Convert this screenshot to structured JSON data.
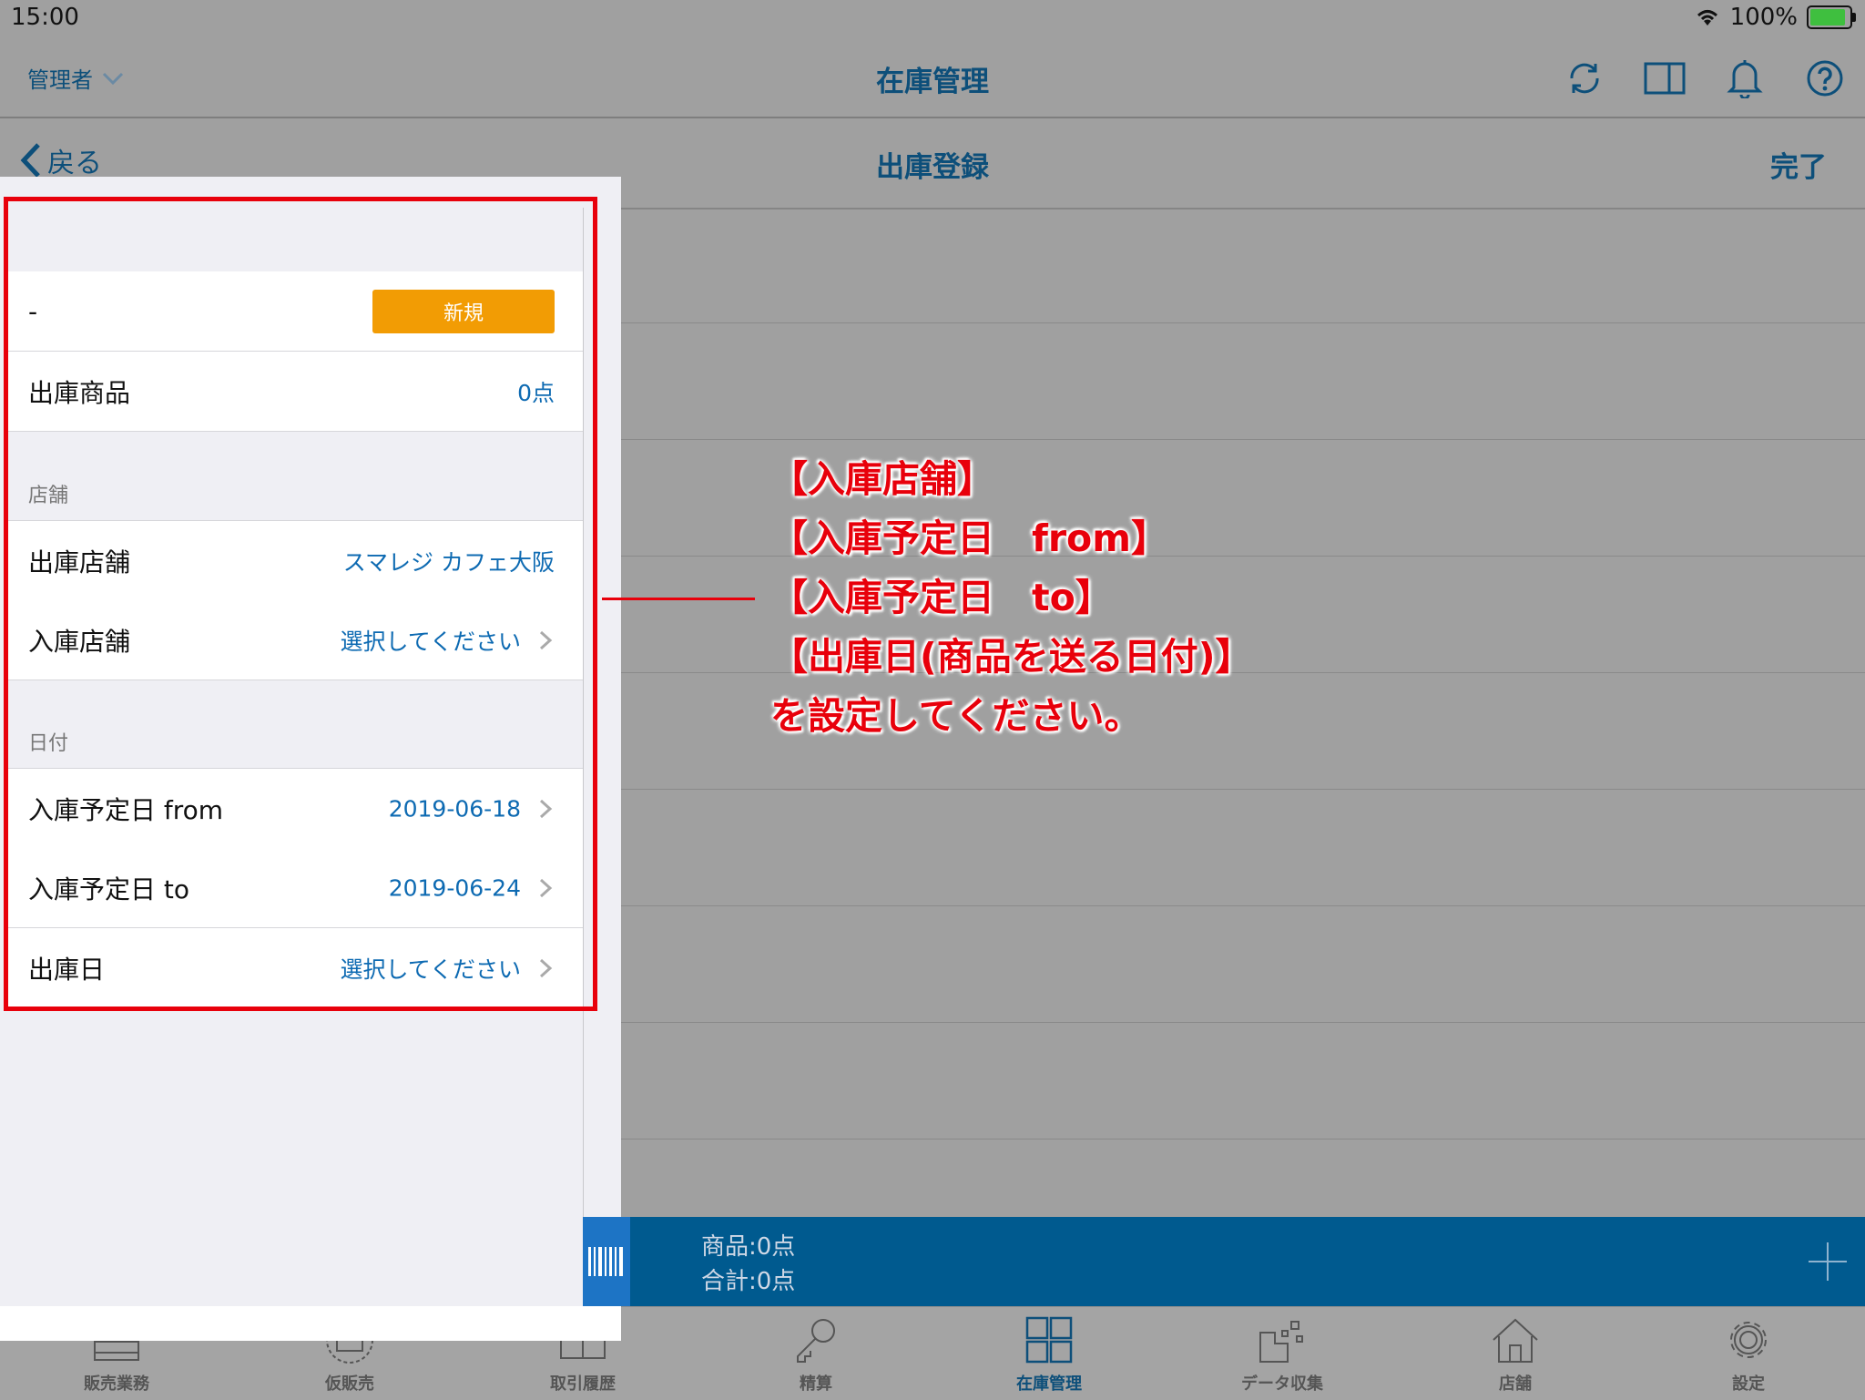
{
  "status_bar": {
    "time": "15:00",
    "battery": "100%",
    "battery_level": 0.9
  },
  "nav": {
    "user": "管理者",
    "title": "在庫管理"
  },
  "sub_nav": {
    "back": "戻る",
    "title": "出庫登録",
    "done": "完了"
  },
  "form": {
    "row_id": {
      "label": "-",
      "badge": "新規"
    },
    "products": {
      "label": "出庫商品",
      "value": "0点"
    },
    "store_section": "店舗",
    "ship_store": {
      "label": "出庫店舗",
      "value": "スマレジ カフェ大阪"
    },
    "receive_store": {
      "label": "入庫店舗",
      "value": "選択してください"
    },
    "date_section": "日付",
    "date_from": {
      "label": "入庫予定日 from",
      "value": "2019-06-18"
    },
    "date_to": {
      "label": "入庫予定日 to",
      "value": "2019-06-24"
    },
    "ship_date": {
      "label": "出庫日",
      "value": "選択してください"
    }
  },
  "annotation": {
    "line1": "【入庫店舗】",
    "line2": "【入庫予定日　from】",
    "line3": "【入庫予定日　to】",
    "line4": "【出庫日(商品を送る日付)】",
    "line5": "を設定してください。"
  },
  "totals": {
    "products": "商品:0点",
    "total": "合計:0点"
  },
  "tabs": [
    {
      "label": "販売業務",
      "icon": "register-icon"
    },
    {
      "label": "仮販売",
      "icon": "temp-register-icon"
    },
    {
      "label": "取引履歴",
      "icon": "book-icon"
    },
    {
      "label": "精算",
      "icon": "key-icon"
    },
    {
      "label": "在庫管理",
      "icon": "inventory-icon",
      "active": true
    },
    {
      "label": "データ収集",
      "icon": "data-icon"
    },
    {
      "label": "店舗",
      "icon": "home-icon"
    },
    {
      "label": "設定",
      "icon": "gear-icon"
    }
  ],
  "colors": {
    "accent": "#0d4f7a",
    "value_blue": "#0d6ab2",
    "badge": "#f29c04",
    "annotation_red": "#e8000b",
    "bottom_bar": "#005a8f"
  }
}
